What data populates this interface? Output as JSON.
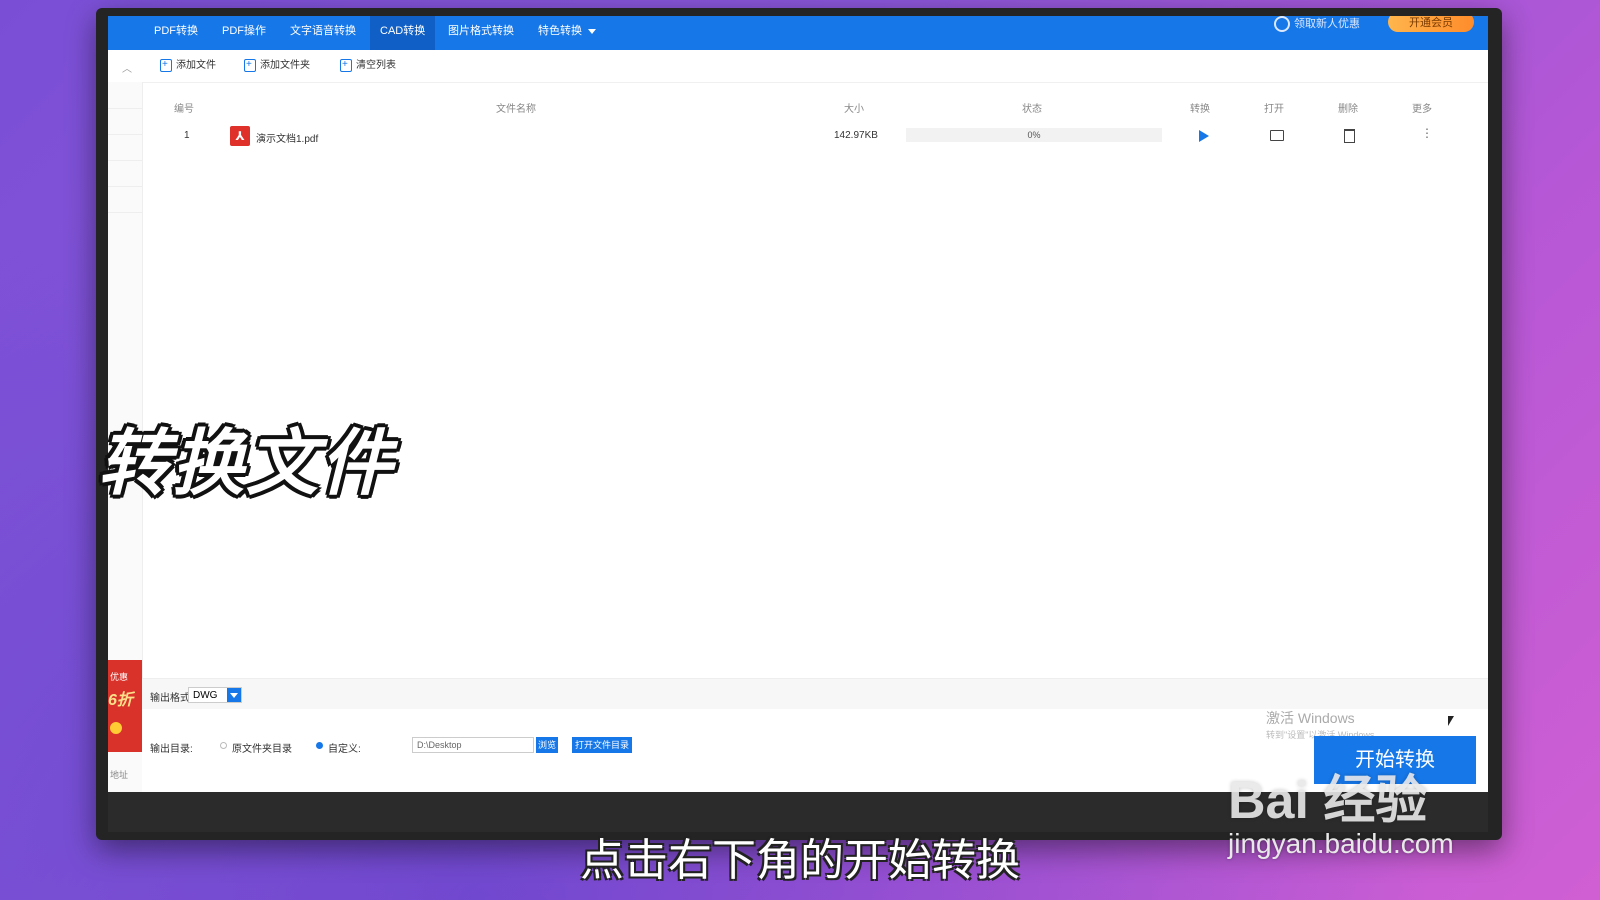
{
  "nav": {
    "items": [
      "PDF转换",
      "PDF操作",
      "文字语音转换",
      "CAD转换",
      "图片格式转换",
      "特色转换"
    ],
    "active_index": 3,
    "user_text": "领取新人优惠",
    "vip_label": "开通会员"
  },
  "toolbar": {
    "add_file": "添加文件",
    "add_folder": "添加文件夹",
    "clear_list": "清空列表"
  },
  "table": {
    "headers": {
      "no": "编号",
      "name": "文件名称",
      "size": "大小",
      "status": "状态",
      "convert": "转换",
      "open": "打开",
      "delete": "删除",
      "more": "更多"
    },
    "rows": [
      {
        "no": "1",
        "name": "演示文档1.pdf",
        "size": "142.97KB",
        "progress_text": "0%",
        "progress": 0
      }
    ]
  },
  "output": {
    "format_label": "输出格式:",
    "format_value": "DWG",
    "dir_label": "输出目录:",
    "source_dir_label": "原文件夹目录",
    "custom_label": "自定义:",
    "path_value": "D:\\Desktop",
    "browse_label": "浏览",
    "open_dir_label": "打开文件目录"
  },
  "promo": {
    "top_text": "优惠",
    "big_text": "6折"
  },
  "address_label": "地址",
  "start_button": "开始转换",
  "windows_watermark": {
    "title": "激活 Windows",
    "subtitle": "转到\"设置\"以激活 Windows。"
  },
  "overlay": {
    "title": "转换文件",
    "subtitle": "点击右下角的开始转换",
    "brand": "Bai  经验",
    "brand_url": "jingyan.baidu.com"
  },
  "colors": {
    "accent": "#1677e8",
    "promo": "#d8322b",
    "vip": "#ffa53d"
  }
}
